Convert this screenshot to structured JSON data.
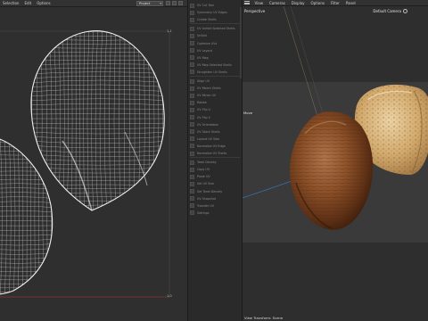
{
  "uv_editor": {
    "menus": [
      "Selection",
      "Edit",
      "Options"
    ],
    "projection_select": "Project",
    "corner_labels": {
      "top_right": "1,1",
      "bottom_right": "1,0"
    }
  },
  "toolkit": {
    "items": [
      "UV Cut Tool",
      "Symmetry UV Edges",
      "Create Shells",
      "UV Unfold Selected Shells",
      "Unfold",
      "Optimize UVs",
      "UV Layout",
      "UV Map",
      "UV Map Selected Shells",
      "Straighten UV Shells",
      "Align UV",
      "UV Match Shells",
      "UV Mirror UV",
      "Rotate",
      "UV Flip U",
      "UV Flip V",
      "UV Orientation",
      "UV Stack Shells",
      "Layout UV Sets",
      "Normalize UV Edge",
      "Normalize UV Shells",
      "Texel Density",
      "Copy UV",
      "Paste UV",
      "Set UV Size",
      "Set Texel Density",
      "UV Snapshot",
      "Transfer UV",
      "Settings"
    ]
  },
  "viewport": {
    "menus": [
      "View",
      "Cameras",
      "Display",
      "Options",
      "Filter",
      "Panel"
    ],
    "label": "Perspective",
    "camera": "Default Camera",
    "move_label": "Move",
    "status": "View Transform: Scene",
    "colors": {
      "almond_dark": "#7a4622",
      "almond_shell": "#d6b07a",
      "uv_wire": "#e8e8e8"
    }
  }
}
